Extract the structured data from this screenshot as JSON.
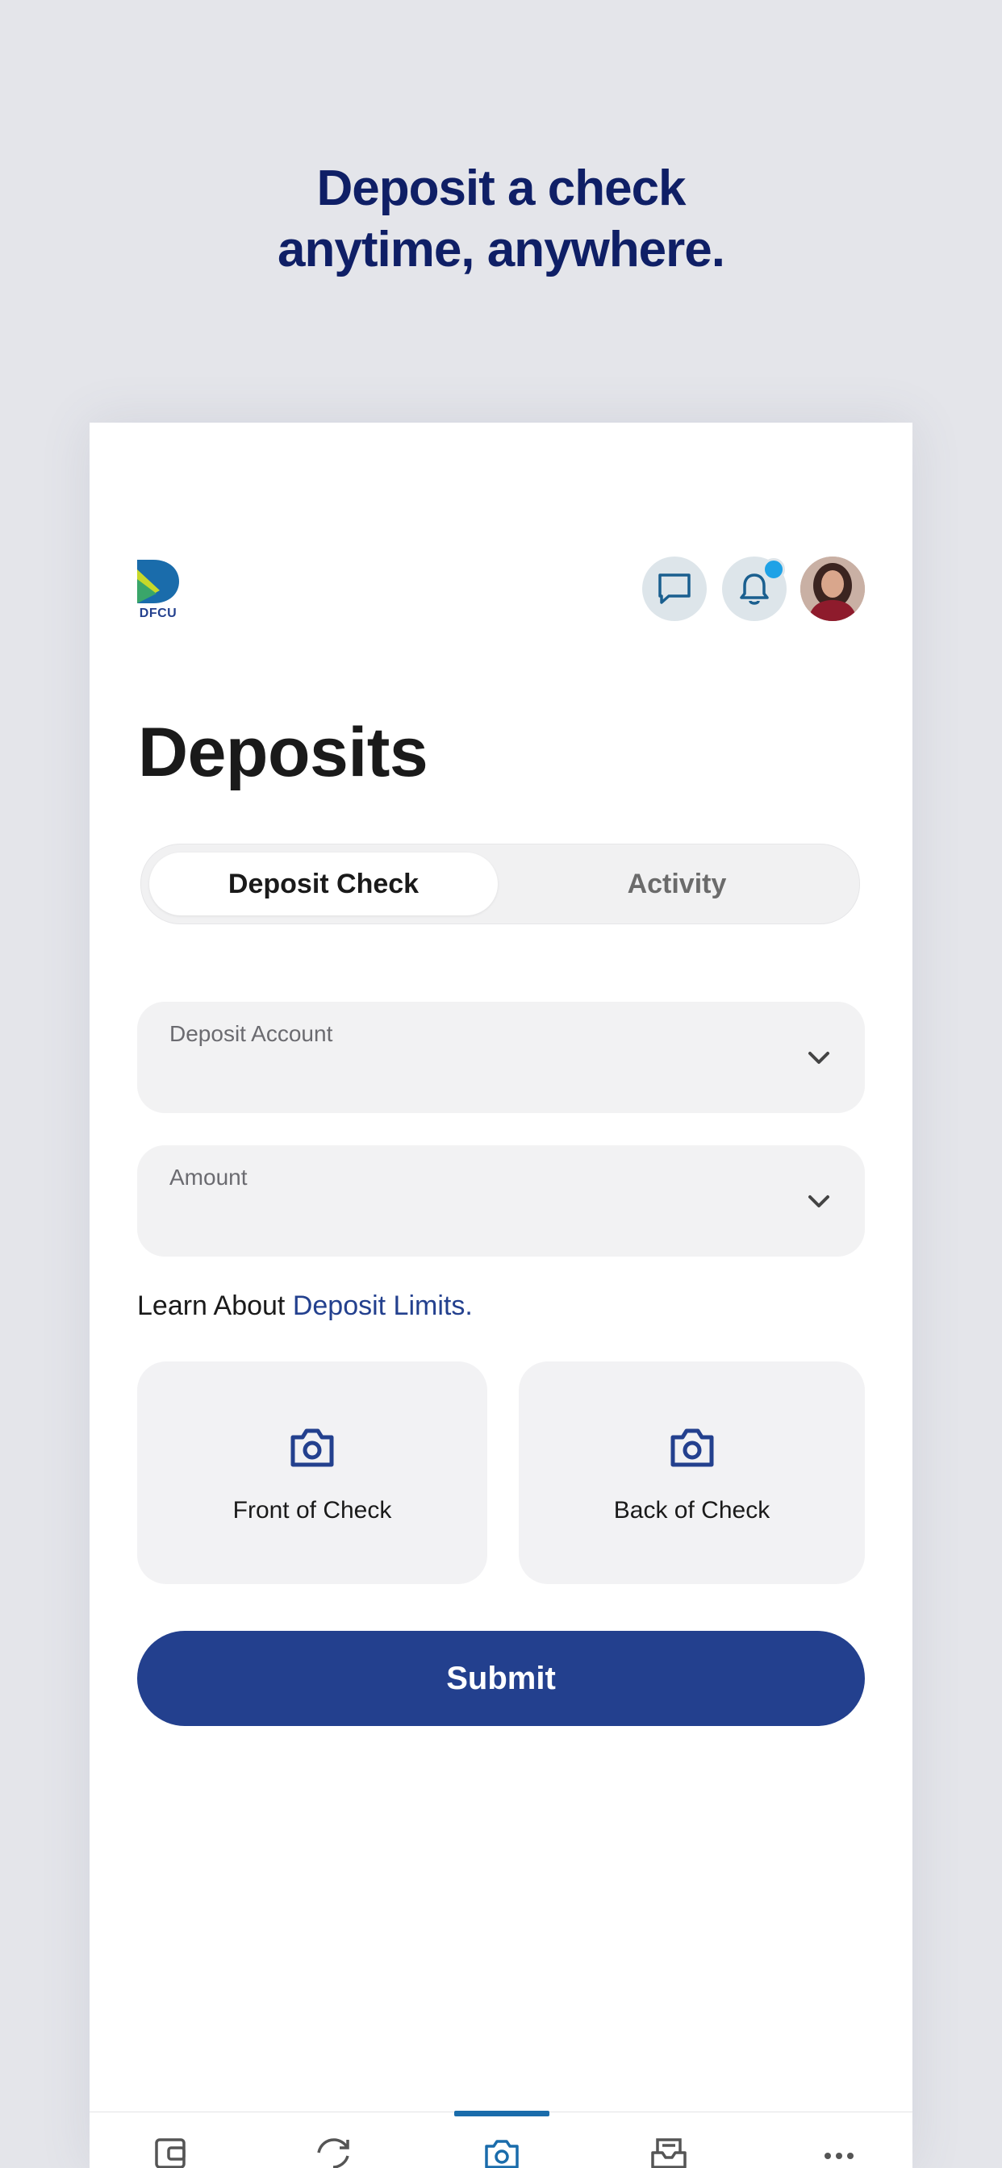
{
  "promo": {
    "headline_line1": "Deposit a check",
    "headline_line2": "anytime, anywhere."
  },
  "header": {
    "logo_text": "DFCU",
    "icons": [
      "chat-icon",
      "bell-icon",
      "avatar"
    ],
    "notification_dot_color": "#1fa2e6"
  },
  "page": {
    "title": "Deposits"
  },
  "tabs": [
    {
      "label": "Deposit Check",
      "active": true
    },
    {
      "label": "Activity",
      "active": false
    }
  ],
  "form": {
    "deposit_account_label": "Deposit Account",
    "amount_label": "Amount"
  },
  "limits": {
    "prefix": "Learn About ",
    "link": "Deposit Limits."
  },
  "capture": {
    "front_label": "Front of Check",
    "back_label": "Back of Check"
  },
  "submit_label": "Submit",
  "tabbar": {
    "items": [
      "wallet-icon",
      "transfer-icon",
      "camera-icon",
      "mailbox-icon",
      "more-icon"
    ],
    "active_index": 2
  },
  "colors": {
    "brand_navy": "#23408e",
    "headline": "#0f1f66",
    "background": "#e4e5ea",
    "tab_active": "#1a6cab"
  }
}
